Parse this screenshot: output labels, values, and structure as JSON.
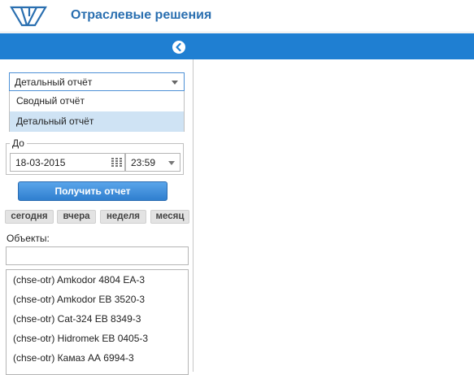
{
  "header": {
    "title": "Отраслевые решения",
    "logo_name": "company-logo"
  },
  "sidebar": {
    "collapse_icon": "chevron-left-icon",
    "report_select": {
      "value": "Детальный отчёт",
      "options": [
        "Сводный отчёт",
        "Детальный отчёт"
      ],
      "selected_index": 1
    },
    "to_legend": "До",
    "date_value": "18-03-2015",
    "time_value": "23:59",
    "get_button_label": "Получить отчет",
    "quick_buttons": [
      "сегодня",
      "вчера",
      "неделя",
      "месяц"
    ],
    "objects_label": "Объекты:",
    "objects_search_value": "",
    "objects": [
      "(chse-otr) Amkodor 4804 EA-3",
      "(chse-otr) Amkodor EB 3520-3",
      "(chse-otr) Cat-324 EB 8349-3",
      "(chse-otr) Hidromek EB 0405-3",
      "(chse-otr) Камаз АА 6994-3"
    ]
  },
  "colors": {
    "band": "#1f7fd2",
    "title": "#2a6fb0",
    "selected_option": "#cfe3f4"
  }
}
